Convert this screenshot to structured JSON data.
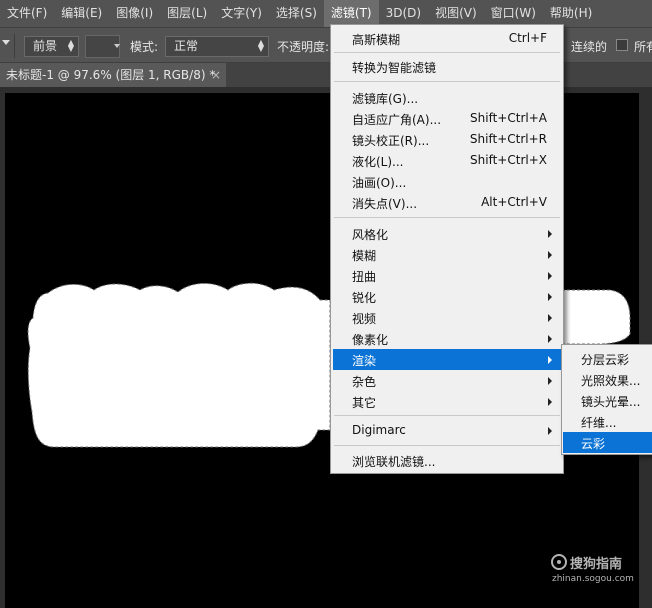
{
  "menubar": {
    "items": [
      "文件(F)",
      "编辑(E)",
      "图像(I)",
      "图层(L)",
      "文字(Y)",
      "选择(S)",
      "滤镜(T)",
      "3D(D)",
      "视图(V)",
      "窗口(W)",
      "帮助(H)"
    ]
  },
  "options": {
    "fill_source": "前景",
    "mode_label": "模式:",
    "mode_value": "正常",
    "opacity_label": "不透明度:",
    "contiguous_label": "连续的",
    "all_layers_label": "所有"
  },
  "document_tab": {
    "title": "未标题-1 @ 97.6% (图层 1, RGB/8) *",
    "close": "×"
  },
  "filter_menu": {
    "last_filter": {
      "label": "高斯模糊",
      "shortcut": "Ctrl+F"
    },
    "convert_smart": {
      "label": "转换为智能滤镜"
    },
    "filter_gallery": {
      "label": "滤镜库(G)..."
    },
    "adaptive_wide": {
      "label": "自适应广角(A)...",
      "shortcut": "Shift+Ctrl+A"
    },
    "lens_correction": {
      "label": "镜头校正(R)...",
      "shortcut": "Shift+Ctrl+R"
    },
    "liquify": {
      "label": "液化(L)...",
      "shortcut": "Shift+Ctrl+X"
    },
    "oil_paint": {
      "label": "油画(O)..."
    },
    "vanishing_point": {
      "label": "消失点(V)...",
      "shortcut": "Alt+Ctrl+V"
    },
    "stylize": {
      "label": "风格化"
    },
    "blur": {
      "label": "模糊"
    },
    "distort": {
      "label": "扭曲"
    },
    "sharpen": {
      "label": "锐化"
    },
    "video": {
      "label": "视频"
    },
    "pixelate": {
      "label": "像素化"
    },
    "render": {
      "label": "渲染"
    },
    "noise": {
      "label": "杂色"
    },
    "other": {
      "label": "其它"
    },
    "digimarc": {
      "label": "Digimarc"
    },
    "browse_online": {
      "label": "浏览联机滤镜..."
    }
  },
  "render_submenu": {
    "difference_clouds": "分层云彩",
    "lighting_effects": "光照效果...",
    "lens_flare": "镜头光晕...",
    "fibers": "纤维...",
    "clouds": "云彩"
  },
  "watermark": {
    "title": "搜狗指南",
    "domain": "zhinan.sogou.com"
  }
}
